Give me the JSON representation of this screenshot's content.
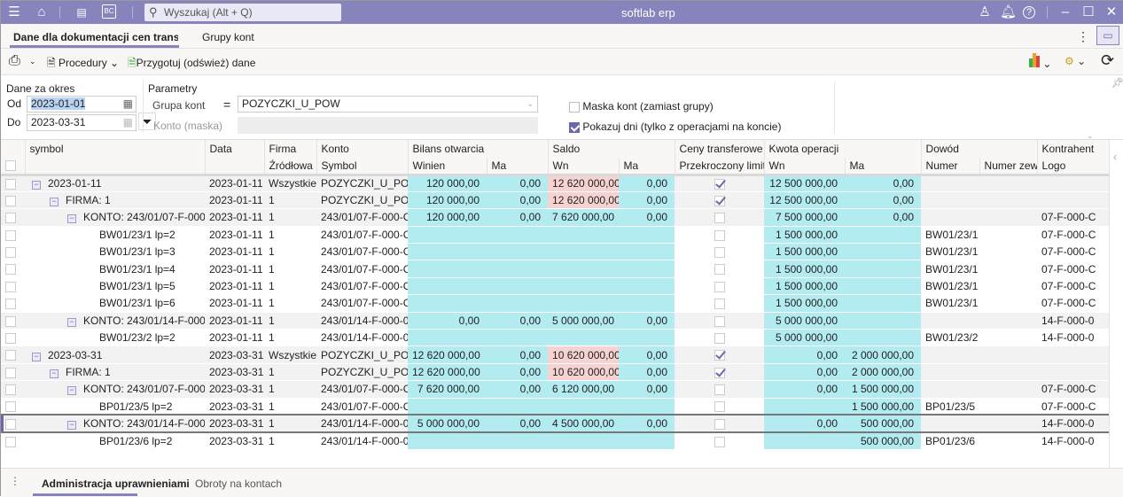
{
  "titlebar": {
    "search_placeholder": "Wyszukaj (Alt + Q)",
    "app_title": "softlab erp"
  },
  "tabs": [
    {
      "label": "Dane dla dokumentacji cen transferow"
    },
    {
      "label": "Grupy kont"
    }
  ],
  "toolbar": {
    "procedures": "Procedury",
    "prepare": "Przygotuj (odśwież) dane"
  },
  "filters": {
    "period_title": "Dane za okres",
    "from_label": "Od",
    "from_value": "2023-01-01",
    "to_label": "Do",
    "to_value": "2023-03-31",
    "params_title": "Parametry",
    "group_label": "Grupa kont",
    "group_operator": "=",
    "group_value": "POZYCZKI_U_POW",
    "mask_label": "Konto (maska)",
    "mask_value": "",
    "mask_accounts_label": "Maska kont (zamiast grupy)",
    "mask_accounts_checked": false,
    "show_days_label": "Pokazuj dni (tylko z operacjami na koncie)",
    "show_days_checked": true
  },
  "grid": {
    "header1": [
      "symbol",
      "Data",
      "Firma",
      "Konto",
      "Bilans otwarcia",
      "Saldo",
      "Ceny transferowe",
      "Kwota operacji",
      "Dowód",
      "Kontrahent"
    ],
    "header2": [
      "",
      "",
      "Źródłowa",
      "Symbol",
      "Winien",
      "Ma",
      "Wn",
      "Ma",
      "Przekroczony limit",
      "Wn",
      "Ma",
      "Numer",
      "Numer zew.",
      "Logo"
    ],
    "rows": [
      {
        "level": 0,
        "symbol": "2023-01-11",
        "data": "2023-01-11",
        "firma": "Wszystkie",
        "konto": "POZYCZKI_U_POW",
        "bo_wn": "120 000,00",
        "bo_ma": "0,00",
        "s_wn": "12 620 000,00",
        "s_wn_alert": true,
        "s_ma": "0,00",
        "limit": true,
        "k_wn": "12 500 000,00",
        "k_ma": "0,00",
        "numer": "",
        "numer_zew": "",
        "logo": ""
      },
      {
        "level": 1,
        "symbol": "FIRMA: 1",
        "data": "2023-01-11",
        "firma": "1",
        "konto": "POZYCZKI_U_POW",
        "bo_wn": "120 000,00",
        "bo_ma": "0,00",
        "s_wn": "12 620 000,00",
        "s_wn_alert": true,
        "s_ma": "0,00",
        "limit": true,
        "k_wn": "12 500 000,00",
        "k_ma": "0,00",
        "numer": "",
        "numer_zew": "",
        "logo": ""
      },
      {
        "level": 2,
        "symbol": "KONTO: 243/01/07-F-000-C",
        "data": "2023-01-11",
        "firma": "1",
        "konto": "243/01/07-F-000-C",
        "bo_wn": "120 000,00",
        "bo_ma": "0,00",
        "s_wn": "7 620 000,00",
        "s_ma": "0,00",
        "limit": false,
        "k_wn": "7 500 000,00",
        "k_ma": "0,00",
        "numer": "",
        "numer_zew": "",
        "logo": "07-F-000-C"
      },
      {
        "level": 3,
        "symbol": "BW01/23/1 lp=2",
        "data": "2023-01-11",
        "firma": "1",
        "konto": "243/01/07-F-000-C",
        "bo_wn": "",
        "bo_ma": "",
        "s_wn": "",
        "s_ma": "",
        "limit": false,
        "k_wn": "1 500 000,00",
        "k_ma": "",
        "numer": "BW01/23/1",
        "numer_zew": "",
        "logo": "07-F-000-C"
      },
      {
        "level": 3,
        "symbol": "BW01/23/1 lp=3",
        "data": "2023-01-11",
        "firma": "1",
        "konto": "243/01/07-F-000-C",
        "bo_wn": "",
        "bo_ma": "",
        "s_wn": "",
        "s_ma": "",
        "limit": false,
        "k_wn": "1 500 000,00",
        "k_ma": "",
        "numer": "BW01/23/1",
        "numer_zew": "",
        "logo": "07-F-000-C"
      },
      {
        "level": 3,
        "symbol": "BW01/23/1 lp=4",
        "data": "2023-01-11",
        "firma": "1",
        "konto": "243/01/07-F-000-C",
        "bo_wn": "",
        "bo_ma": "",
        "s_wn": "",
        "s_ma": "",
        "limit": false,
        "k_wn": "1 500 000,00",
        "k_ma": "",
        "numer": "BW01/23/1",
        "numer_zew": "",
        "logo": "07-F-000-C"
      },
      {
        "level": 3,
        "symbol": "BW01/23/1 lp=5",
        "data": "2023-01-11",
        "firma": "1",
        "konto": "243/01/07-F-000-C",
        "bo_wn": "",
        "bo_ma": "",
        "s_wn": "",
        "s_ma": "",
        "limit": false,
        "k_wn": "1 500 000,00",
        "k_ma": "",
        "numer": "BW01/23/1",
        "numer_zew": "",
        "logo": "07-F-000-C"
      },
      {
        "level": 3,
        "symbol": "BW01/23/1 lp=6",
        "data": "2023-01-11",
        "firma": "1",
        "konto": "243/01/07-F-000-C",
        "bo_wn": "",
        "bo_ma": "",
        "s_wn": "",
        "s_ma": "",
        "limit": false,
        "k_wn": "1 500 000,00",
        "k_ma": "",
        "numer": "BW01/23/1",
        "numer_zew": "",
        "logo": "07-F-000-C"
      },
      {
        "level": 2,
        "symbol": "KONTO: 243/01/14-F-000-0",
        "data": "2023-01-11",
        "firma": "1",
        "konto": "243/01/14-F-000-0",
        "bo_wn": "0,00",
        "bo_ma": "0,00",
        "s_wn": "5 000 000,00",
        "s_ma": "0,00",
        "limit": false,
        "k_wn": "5 000 000,00",
        "k_ma": "",
        "numer": "",
        "numer_zew": "",
        "logo": "14-F-000-0"
      },
      {
        "level": 3,
        "symbol": "BW01/23/2 lp=2",
        "data": "2023-01-11",
        "firma": "1",
        "konto": "243/01/14-F-000-0",
        "bo_wn": "",
        "bo_ma": "",
        "s_wn": "",
        "s_ma": "",
        "limit": false,
        "k_wn": "5 000 000,00",
        "k_ma": "",
        "numer": "BW01/23/2",
        "numer_zew": "",
        "logo": "14-F-000-0"
      },
      {
        "level": 0,
        "symbol": "2023-03-31",
        "data": "2023-03-31",
        "firma": "Wszystkie",
        "konto": "POZYCZKI_U_POW",
        "bo_wn": "12 620 000,00",
        "bo_ma": "0,00",
        "s_wn": "10 620 000,00",
        "s_wn_alert": true,
        "s_ma": "0,00",
        "limit": true,
        "k_wn": "0,00",
        "k_ma": "2 000 000,00",
        "numer": "",
        "numer_zew": "",
        "logo": ""
      },
      {
        "level": 1,
        "symbol": "FIRMA: 1",
        "data": "2023-03-31",
        "firma": "1",
        "konto": "POZYCZKI_U_POW",
        "bo_wn": "12 620 000,00",
        "bo_ma": "0,00",
        "s_wn": "10 620 000,00",
        "s_wn_alert": true,
        "s_ma": "0,00",
        "limit": true,
        "k_wn": "0,00",
        "k_ma": "2 000 000,00",
        "numer": "",
        "numer_zew": "",
        "logo": ""
      },
      {
        "level": 2,
        "symbol": "KONTO: 243/01/07-F-000-C",
        "data": "2023-03-31",
        "firma": "1",
        "konto": "243/01/07-F-000-C",
        "bo_wn": "7 620 000,00",
        "bo_ma": "0,00",
        "s_wn": "6 120 000,00",
        "s_ma": "0,00",
        "limit": false,
        "k_wn": "0,00",
        "k_ma": "1 500 000,00",
        "numer": "",
        "numer_zew": "",
        "logo": "07-F-000-C"
      },
      {
        "level": 3,
        "symbol": "BP01/23/5 lp=2",
        "data": "2023-03-31",
        "firma": "1",
        "konto": "243/01/07-F-000-C",
        "bo_wn": "",
        "bo_ma": "",
        "s_wn": "",
        "s_ma": "",
        "limit": false,
        "k_wn": "",
        "k_ma": "1 500 000,00",
        "numer": "BP01/23/5",
        "numer_zew": "",
        "logo": "07-F-000-C"
      },
      {
        "level": 2,
        "selected": true,
        "symbol": "KONTO: 243/01/14-F-000-0",
        "data": "2023-03-31",
        "firma": "1",
        "konto": "243/01/14-F-000-0",
        "bo_wn": "5 000 000,00",
        "bo_ma": "0,00",
        "s_wn": "4 500 000,00",
        "s_ma": "0,00",
        "limit": false,
        "k_wn": "0,00",
        "k_ma": "500 000,00",
        "numer": "",
        "numer_zew": "",
        "logo": "14-F-000-0"
      },
      {
        "level": 3,
        "symbol": "BP01/23/6 lp=2",
        "data": "2023-03-31",
        "firma": "1",
        "konto": "243/01/14-F-000-0",
        "bo_wn": "",
        "bo_ma": "",
        "s_wn": "",
        "s_ma": "",
        "limit": false,
        "k_wn": "",
        "k_ma": "500 000,00",
        "numer": "BP01/23/6",
        "numer_zew": "",
        "logo": "14-F-000-0"
      }
    ]
  },
  "bottom_tabs": [
    {
      "label": "Administracja uprawnieniami"
    },
    {
      "label": "Obroty na kontach"
    }
  ],
  "colors": {
    "accent": "#8683bd",
    "cyan_cell": "#b2ebf0",
    "alert_cell": "#f6d3d1"
  }
}
